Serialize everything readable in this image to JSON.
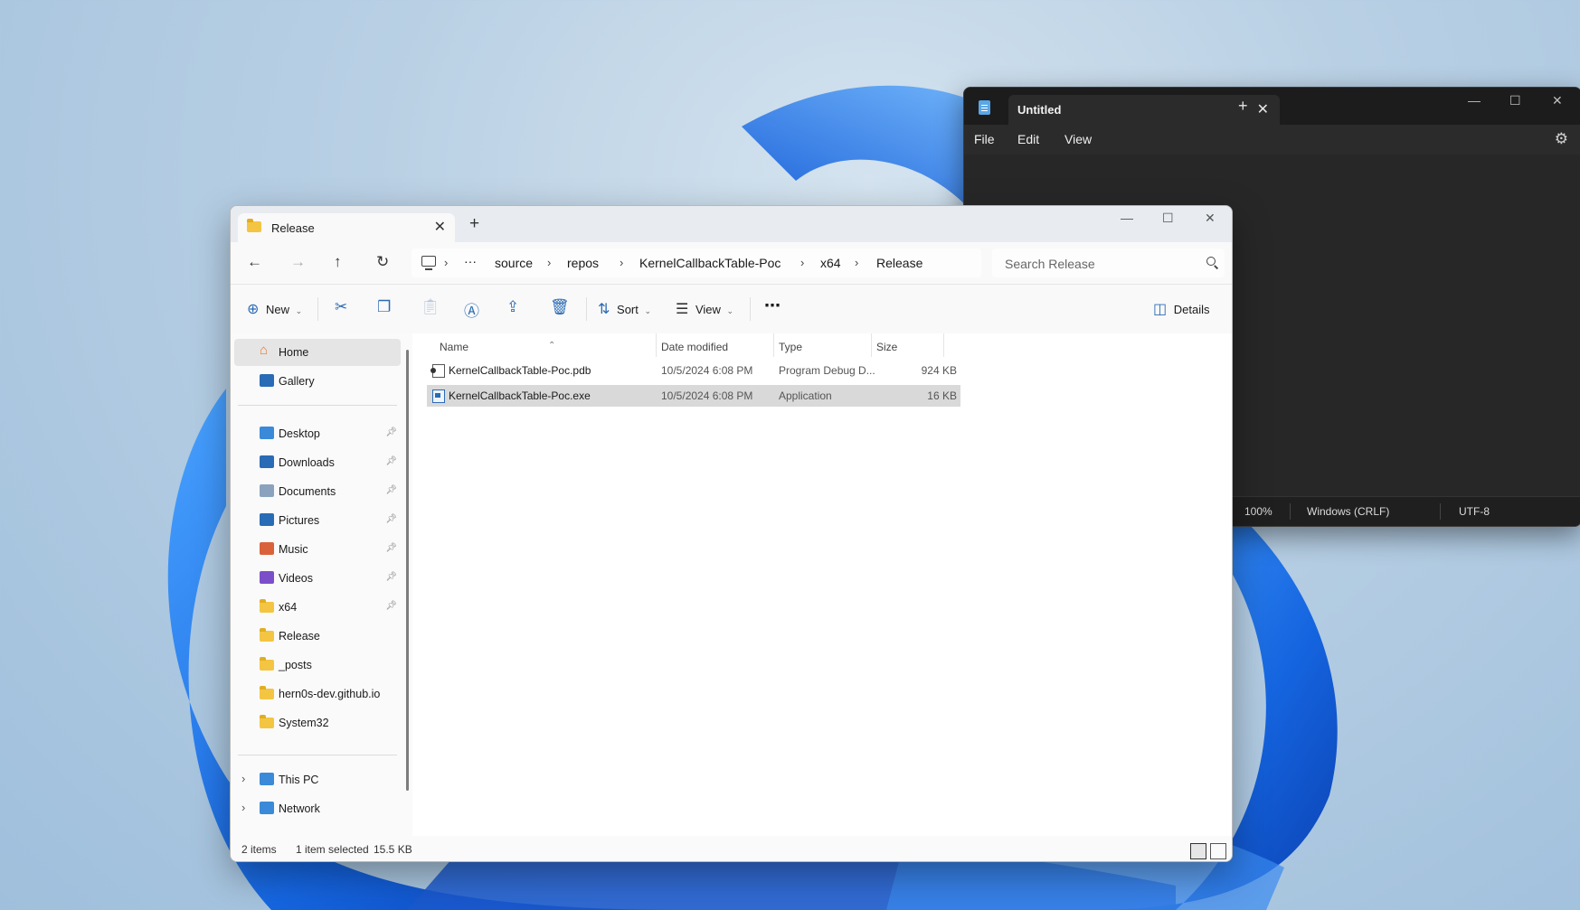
{
  "notepad": {
    "tab_title": "Untitled",
    "menu": [
      "File",
      "Edit",
      "View"
    ],
    "status": {
      "zoom": "100%",
      "line_ending": "Windows (CRLF)",
      "encoding": "UTF-8"
    }
  },
  "explorer": {
    "tab_title": "Release",
    "breadcrumb": [
      "source",
      "repos",
      "KernelCallbackTable-Poc",
      "x64",
      "Release"
    ],
    "overflow": "···",
    "search_placeholder": "Search Release",
    "toolbar": {
      "new_label": "New",
      "sort_label": "Sort",
      "view_label": "View",
      "details_label": "Details"
    },
    "nav": {
      "top": [
        {
          "label": "Home",
          "icon": "home-icon"
        },
        {
          "label": "Gallery",
          "icon": "gallery-icon"
        }
      ],
      "quick": [
        {
          "label": "Desktop",
          "pinned": true
        },
        {
          "label": "Downloads",
          "pinned": true
        },
        {
          "label": "Documents",
          "pinned": true
        },
        {
          "label": "Pictures",
          "pinned": true
        },
        {
          "label": "Music",
          "pinned": true
        },
        {
          "label": "Videos",
          "pinned": true
        },
        {
          "label": "x64",
          "pinned": true
        },
        {
          "label": "Release",
          "pinned": false
        },
        {
          "label": "_posts",
          "pinned": false
        },
        {
          "label": "hern0s-dev.github.io",
          "pinned": false
        },
        {
          "label": "System32",
          "pinned": false
        }
      ],
      "bottom": [
        {
          "label": "This PC"
        },
        {
          "label": "Network"
        }
      ]
    },
    "columns": [
      "Name",
      "Date modified",
      "Type",
      "Size"
    ],
    "files": [
      {
        "name": "KernelCallbackTable-Poc.pdb",
        "date": "10/5/2024 6:08 PM",
        "type": "Program Debug D...",
        "size": "924 KB",
        "selected": false
      },
      {
        "name": "KernelCallbackTable-Poc.exe",
        "date": "10/5/2024 6:08 PM",
        "type": "Application",
        "size": "16 KB",
        "selected": true
      }
    ],
    "status": {
      "items": "2 items",
      "selection": "1 item selected",
      "selection_size": "15.5 KB"
    }
  },
  "colors": {
    "accent": "#2a6bb5",
    "notepad_bg": "#202020",
    "selection": "#d9d9d9"
  }
}
